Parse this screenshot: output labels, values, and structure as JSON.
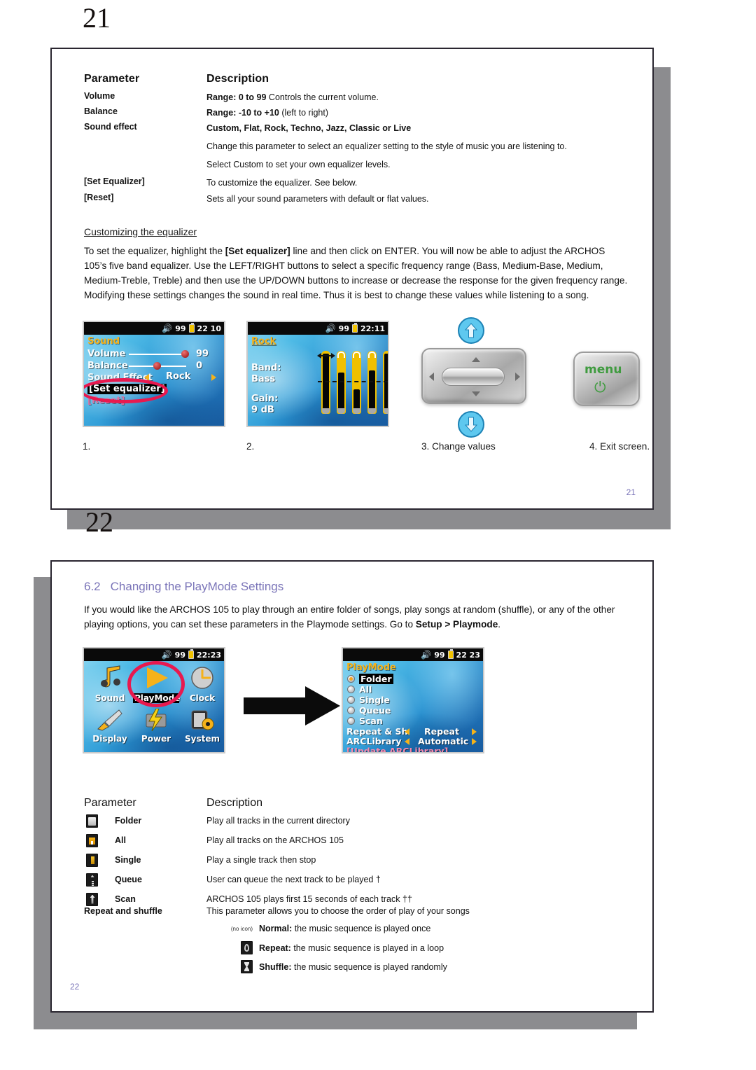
{
  "page21": {
    "big_marker": "21",
    "footer_number": "21",
    "table": {
      "header_parameter": "Parameter",
      "header_description": "Description",
      "rows": [
        {
          "parameter": "Volume",
          "desc_bold": "Range: 0 to 99",
          "desc_rest": " Controls the current volume."
        },
        {
          "parameter": "Balance",
          "desc_bold": "Range: -10 to +10",
          "desc_rest": " (left to right)"
        },
        {
          "parameter": "Sound effect",
          "desc_bold": "Custom, Flat, Rock, Techno, Jazz, Classic or Live",
          "desc_rest": ""
        },
        {
          "parameter": "",
          "desc_bold": "",
          "desc_rest": "Change this parameter to select an equalizer setting to the style of music you are listening to."
        },
        {
          "parameter": "",
          "desc_bold": "",
          "desc_rest": "Select Custom to set your own equalizer levels."
        },
        {
          "parameter": "[Set Equalizer]",
          "desc_bold": "",
          "desc_rest": "To customize the equalizer. See below."
        },
        {
          "parameter": "[Reset]",
          "desc_bold": "",
          "desc_rest": "Sets all your sound parameters with default or flat values."
        }
      ]
    },
    "subheading": "Customizing the equalizer",
    "body_part1": "To set the equalizer, highlight the ",
    "body_bold": "[Set equalizer]",
    "body_part2": " line and then click on ENTER. You will now be able to adjust the ARCHOS 105’s five band equalizer. Use the LEFT/RIGHT buttons to select a specific frequency range (Bass, Medium-Base, Medium, Medium-Treble, Treble) and then use the UP/DOWN buttons to increase or decrease the response for the given frequency range. Modifying these settings changes the sound in real time. Thus it is best to change these values while listening to a song.",
    "screen_sound": {
      "status_volume": "99",
      "status_time": "22 10",
      "title": "Sound",
      "label_volume": "Volume",
      "value_volume": "99",
      "label_balance": "Balance",
      "value_balance": "0",
      "label_soundeffect": "Sound Effect",
      "value_soundeffect": "Rock",
      "selected_item": "[Set equalizer]",
      "hidden_item": "[Reset]"
    },
    "screen_equalizer": {
      "status_volume": "99",
      "status_time": "22:11",
      "title": "Rock",
      "label_band": "Band:",
      "value_band": "Bass",
      "label_gain": "Gain:",
      "value_gain": "9 dB",
      "band_levels": [
        100,
        66,
        34,
        70,
        100
      ]
    },
    "captions": [
      {
        "text": "1."
      },
      {
        "text": "2."
      },
      {
        "text": "3. Change values"
      },
      {
        "text": "4. Exit screen."
      }
    ],
    "menu_button": {
      "label": "menu",
      "power_glyph": "⏻"
    }
  },
  "page22": {
    "big_marker": "22",
    "footer_number": "22",
    "section_number": "6.2",
    "section_title": "Changing the PlayMode Settings",
    "intro_part1": "If you would like the ARCHOS 105 to play through an entire folder of songs, play songs at random (shuffle), or any of the other playing options, you can set these parameters in the Playmode settings. Go to ",
    "intro_bold": "Setup > Playmode",
    "intro_part2": ".",
    "screen_setup": {
      "status_volume": "99",
      "status_time": "22:23",
      "items": [
        "Sound",
        "PlayMode",
        "Clock",
        "Display",
        "Power",
        "System"
      ],
      "selected": "PlayMode"
    },
    "screen_playmode": {
      "status_volume": "99",
      "status_time": "22 23",
      "title": "PlayMode",
      "options": [
        "Folder",
        "All",
        "Single",
        "Queue",
        "Scan"
      ],
      "selected_option": "Folder",
      "row_repeat_label": "Repeat & Sh",
      "row_repeat_value": "Repeat",
      "row_arclibrary_label": "ARCLibrary",
      "row_arclibrary_value": "Automatic",
      "update_item": "[Update ARCLibrary]"
    },
    "table": {
      "header_parameter": "Parameter",
      "header_description": "Description",
      "rows": [
        {
          "icon": "folder-icon",
          "label": "Folder",
          "desc": "Play all tracks in the current directory"
        },
        {
          "icon": "all-icon",
          "label": "All",
          "desc": "Play all tracks on the ARCHOS 105"
        },
        {
          "icon": "single-icon",
          "label": "Single",
          "desc": "Play a single track then stop"
        },
        {
          "icon": "queue-icon",
          "label": "Queue",
          "desc": "User can queue the next track to be played †"
        },
        {
          "icon": "scan-icon",
          "label": "Scan",
          "desc": "ARCHOS 105 plays first 15 seconds of each track ††"
        }
      ]
    },
    "repeat_shuffle": {
      "label": "Repeat and shuffle",
      "desc": "This parameter allows you to choose the order of play of your songs",
      "items": [
        {
          "icon": "no-icon",
          "icon_text": "(no icon)",
          "bold": "Normal:",
          "rest": " the music sequence is played once"
        },
        {
          "icon": "repeat-icon",
          "icon_text": "",
          "bold": "Repeat:",
          "rest": " the music sequence is played in a loop"
        },
        {
          "icon": "shuffle-icon",
          "icon_text": "",
          "bold": "Shuffle:",
          "rest": " the music sequence is played randomly"
        }
      ]
    }
  }
}
